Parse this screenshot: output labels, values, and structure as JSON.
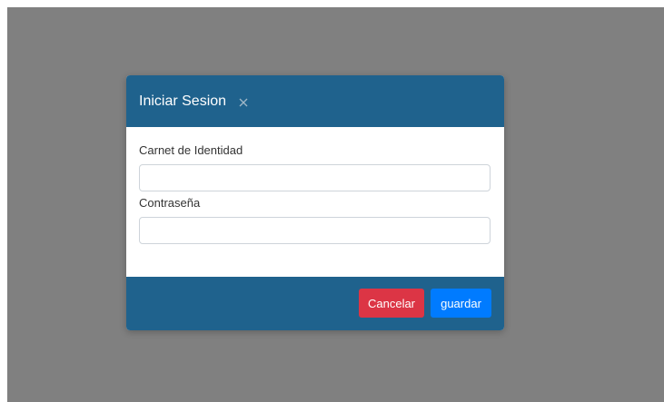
{
  "modal": {
    "title": "Iniciar Sesion",
    "close_icon": "close-icon",
    "fields": [
      {
        "label": "Carnet de Identidad",
        "value": "",
        "placeholder": ""
      },
      {
        "label": "Contraseña",
        "value": "",
        "placeholder": ""
      }
    ],
    "buttons": {
      "cancel_label": "Cancelar",
      "save_label": "guardar"
    }
  },
  "colors": {
    "backdrop": "#808080",
    "header_footer": "#1f628d",
    "cancel_button": "#dc3545",
    "save_button": "#007bff"
  }
}
